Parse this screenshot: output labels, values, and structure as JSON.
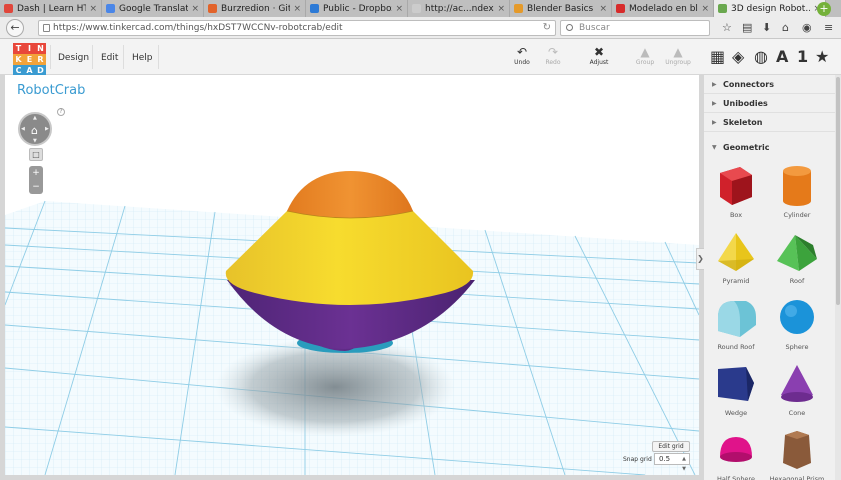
{
  "tabs": [
    {
      "title": "Dash | Learn HT...",
      "favicon_color": "#e0463b"
    },
    {
      "title": "Google Translate",
      "favicon_color": "#4a86e8"
    },
    {
      "title": "Burzredion · Git...",
      "favicon_color": "#e2632a"
    },
    {
      "title": "Public - Dropbox",
      "favicon_color": "#2d7ad6"
    },
    {
      "title": "http://ac...ndex.html",
      "favicon_color": "#cccccc"
    },
    {
      "title": "Blender Basics « ...",
      "favicon_color": "#e59a2a"
    },
    {
      "title": "Modelado en bl...",
      "favicon_color": "#d72b2b"
    },
    {
      "title": "3D design Robot...",
      "favicon_color": "#6aa84f",
      "active": true
    }
  ],
  "tab_close": "×",
  "new_tab": "+",
  "address": {
    "url": "https://www.tinkercad.com/things/hxDST7WCCNv-robotcrab/edit",
    "search_placeholder": "Buscar"
  },
  "logo": {
    "letters": [
      "T",
      "I",
      "N",
      "K",
      "E",
      "R",
      "C",
      "A",
      "D"
    ],
    "colors": [
      "#e8473b",
      "#e8473b",
      "#e8473b",
      "#f2a33a",
      "#f2a33a",
      "#f2a33a",
      "#3a9bd1",
      "#3a9bd1",
      "#3a9bd1"
    ]
  },
  "menu": {
    "design": "Design",
    "edit": "Edit",
    "help": "Help"
  },
  "tools": {
    "undo": "Undo",
    "redo": "Redo",
    "adjust": "Adjust",
    "group": "Group",
    "ungroup": "Ungroup"
  },
  "right_tools": {
    "count": "1"
  },
  "design_title": "RobotCrab",
  "help_mark": "?",
  "edit_grid": "Edit grid",
  "snap_grid": {
    "label": "Snap grid",
    "value": "0.5"
  },
  "categories": [
    "Connectors",
    "Unibodies",
    "Skeleton"
  ],
  "geometric": {
    "title": "Geometric",
    "shapes": [
      {
        "name": "Box",
        "color": "#d0212b"
      },
      {
        "name": "Cylinder",
        "color": "#e57a1a"
      },
      {
        "name": "Pyramid",
        "color": "#e8c51b"
      },
      {
        "name": "Roof",
        "color": "#3ca33c"
      },
      {
        "name": "Round Roof",
        "color": "#6cc3d6"
      },
      {
        "name": "Sphere",
        "color": "#1b93d9"
      },
      {
        "name": "Wedge",
        "color": "#2a3a8c"
      },
      {
        "name": "Cone",
        "color": "#8a3fb0"
      },
      {
        "name": "Half Sphere",
        "color": "#e0138a"
      },
      {
        "name": "Hexagonal Prism",
        "color": "#8a5a3a"
      }
    ]
  }
}
